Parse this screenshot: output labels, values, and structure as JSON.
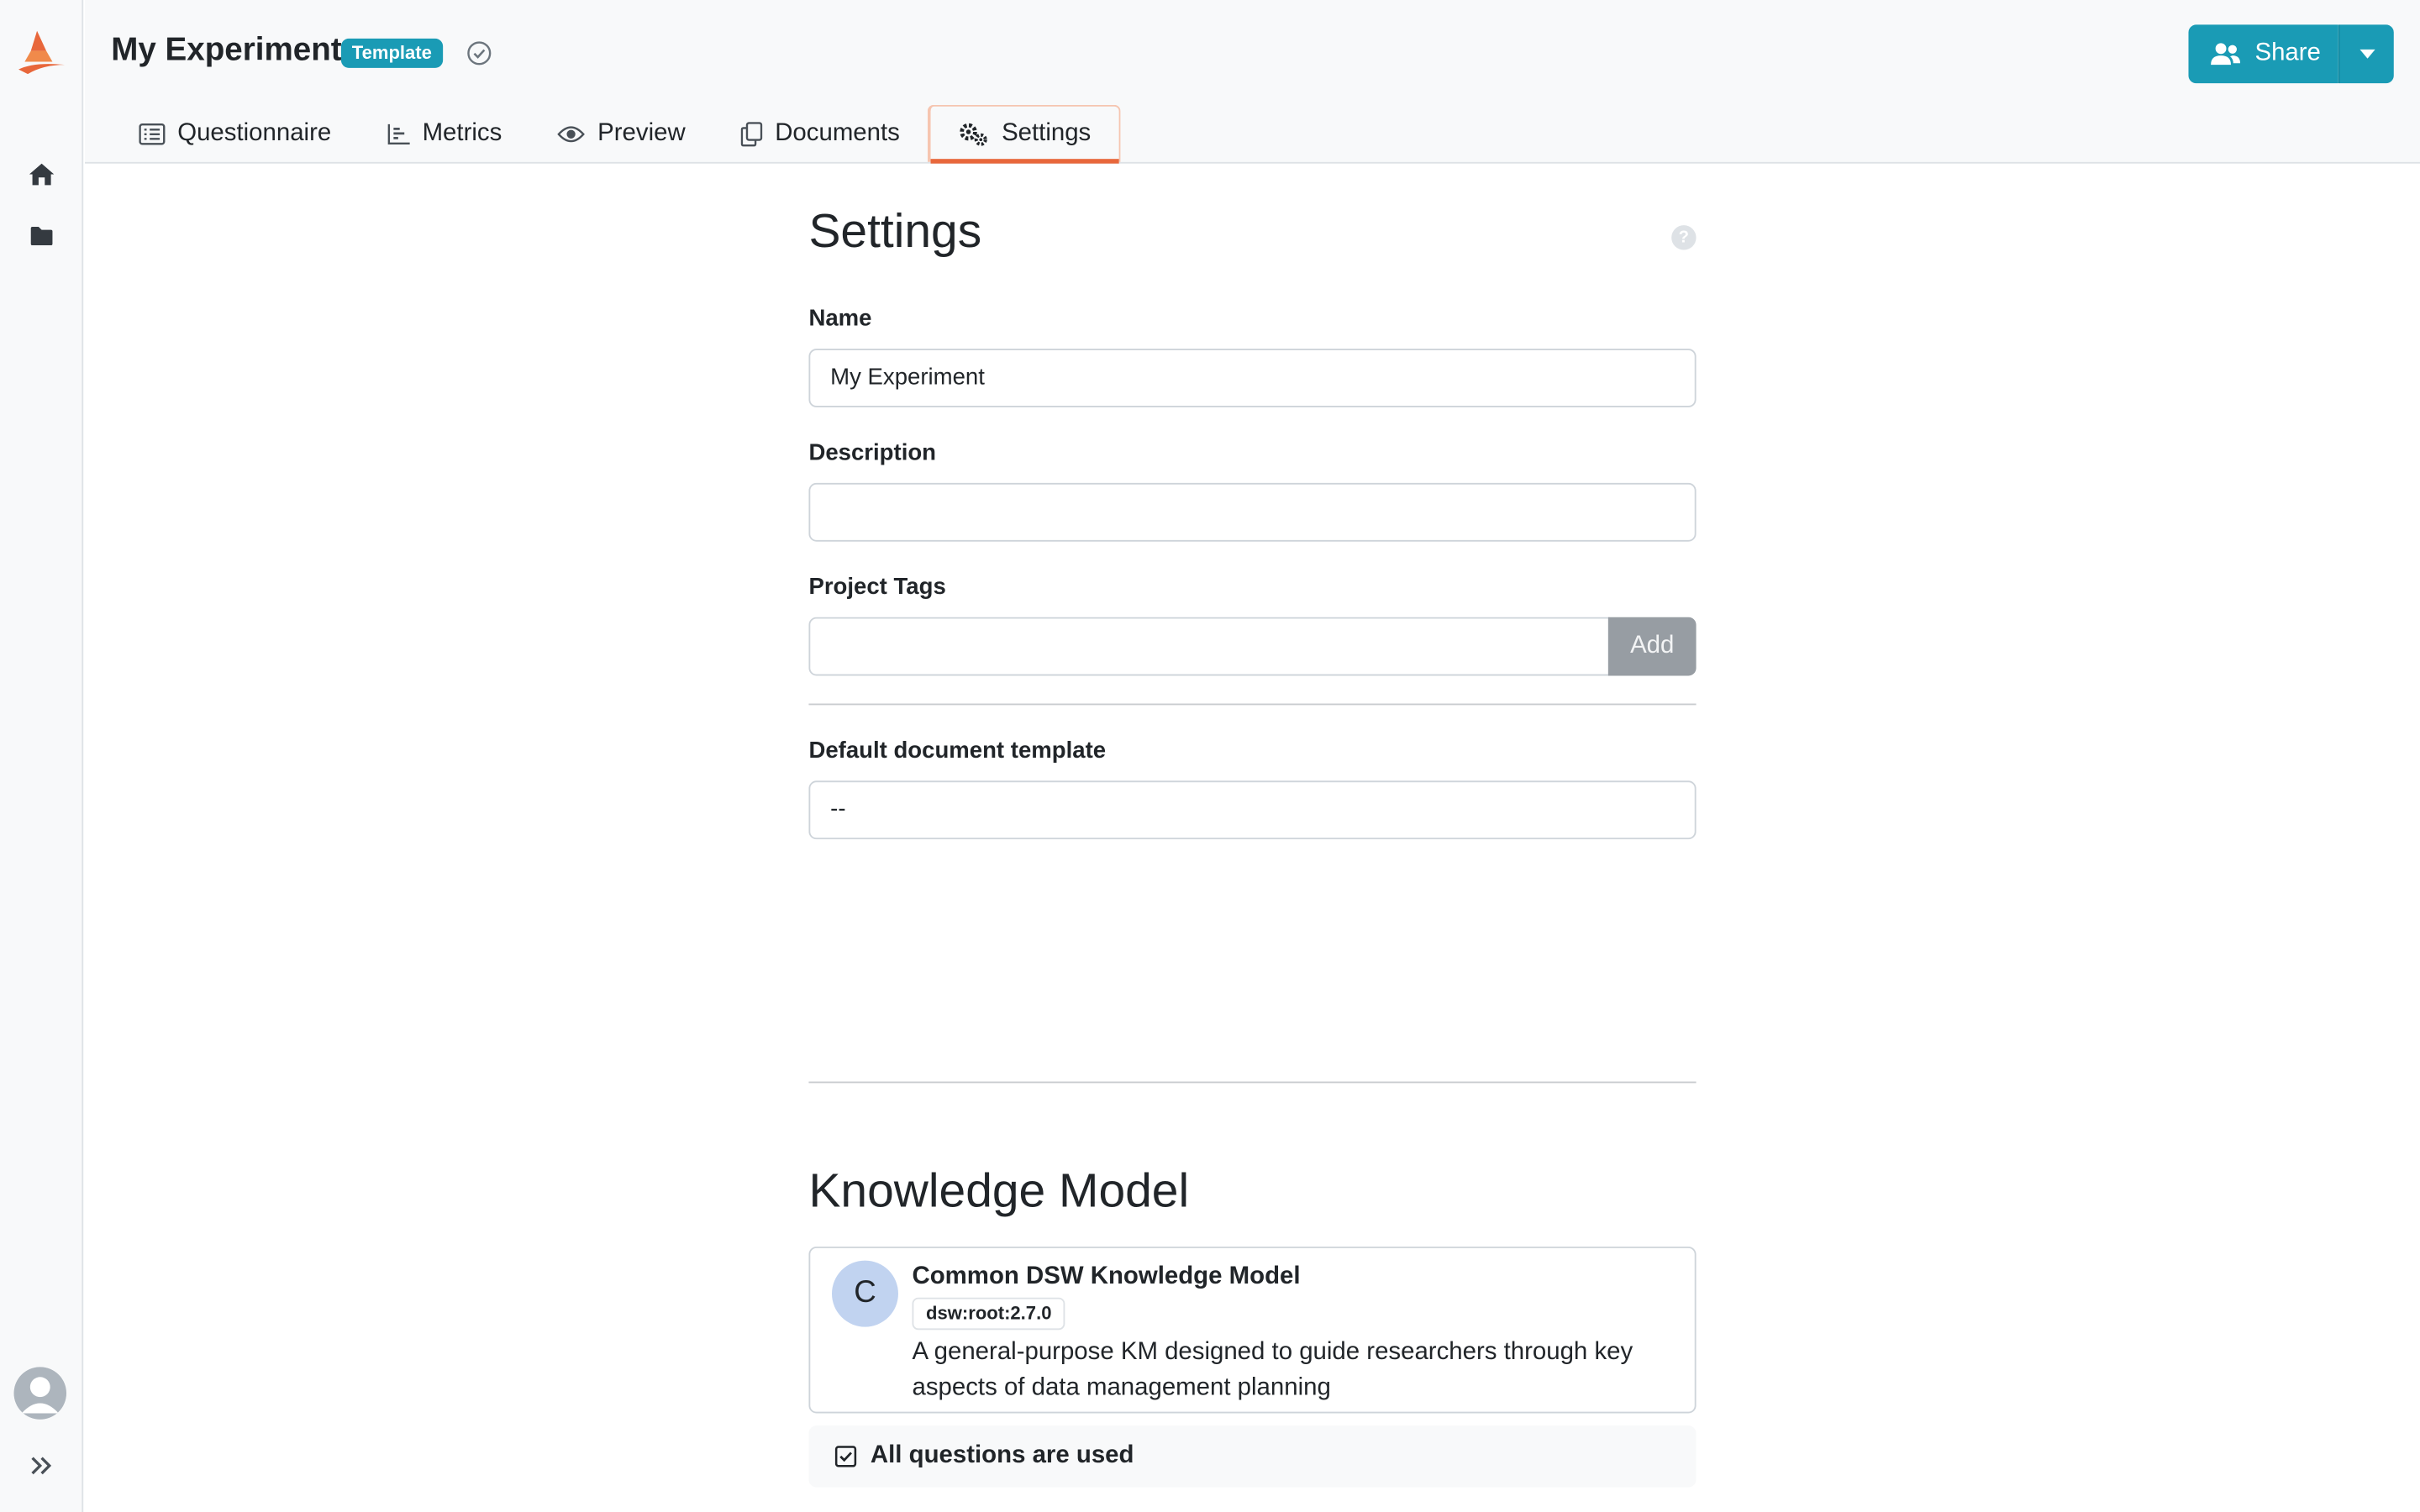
{
  "project": {
    "title": "My Experiment",
    "badge": "Template"
  },
  "header": {
    "share_label": "Share"
  },
  "tabs": [
    {
      "label": "Questionnaire",
      "icon": "list-icon"
    },
    {
      "label": "Metrics",
      "icon": "bar-chart-icon"
    },
    {
      "label": "Preview",
      "icon": "eye-icon"
    },
    {
      "label": "Documents",
      "icon": "copy-icon"
    },
    {
      "label": "Settings",
      "icon": "gears-icon",
      "active": true
    }
  ],
  "settings": {
    "heading": "Settings",
    "help": "?",
    "name_label": "Name",
    "name_value": "My Experiment",
    "description_label": "Description",
    "description_value": "",
    "tags_label": "Project Tags",
    "tags_value": "",
    "add_label": "Add",
    "template_label": "Default document template",
    "template_value": "--"
  },
  "knowledge_model": {
    "heading": "Knowledge Model",
    "avatar_letter": "C",
    "name": "Common DSW Knowledge Model",
    "id": "dsw:root:2.7.0",
    "description": "A general-purpose KM designed to guide researchers through key aspects of data management planning",
    "all_used": "All questions are used"
  },
  "colors": {
    "primary": "#1a9bb5",
    "accent": "#e8673b",
    "sidebar_bg": "#f8f9fa",
    "disabled_button": "#979da3"
  }
}
